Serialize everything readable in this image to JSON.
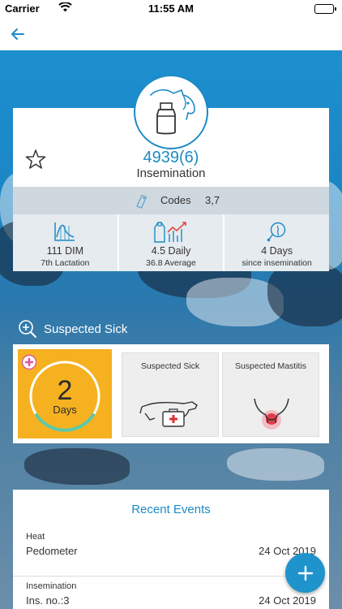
{
  "status_bar": {
    "carrier": "Carrier",
    "time": "11:55 AM"
  },
  "cow": {
    "number": "4939",
    "lactation_paren": "(6)",
    "status": "Insemination"
  },
  "codes": {
    "label": "Codes",
    "value": "3,7"
  },
  "stats": [
    {
      "main": "111 DIM",
      "sub": "7th Lactation",
      "icon": "lactation-curve-icon"
    },
    {
      "main": "4.5 Daily",
      "sub": "36.8 Average",
      "icon": "milk-chart-icon"
    },
    {
      "main": "4 Days",
      "sub": "since insemination",
      "icon": "insemination-icon"
    }
  ],
  "section": {
    "title": "Suspected Sick"
  },
  "days_tile": {
    "number": "2",
    "label": "Days"
  },
  "alerts": [
    {
      "label": "Suspected Sick",
      "icon": "sick-cow-icon"
    },
    {
      "label": "Suspected Mastitis",
      "icon": "udder-icon"
    }
  ],
  "events": {
    "title": "Recent Events",
    "items": [
      {
        "type": "Heat",
        "detail": "Pedometer",
        "date": "24 Oct 2019"
      },
      {
        "type": "Insemination",
        "detail": "Ins. no.:3",
        "date": "24 Oct 2019"
      }
    ]
  },
  "colors": {
    "accent": "#1c8bc4",
    "days_tile": "#f5b120",
    "ring": "#5cc9a7"
  }
}
